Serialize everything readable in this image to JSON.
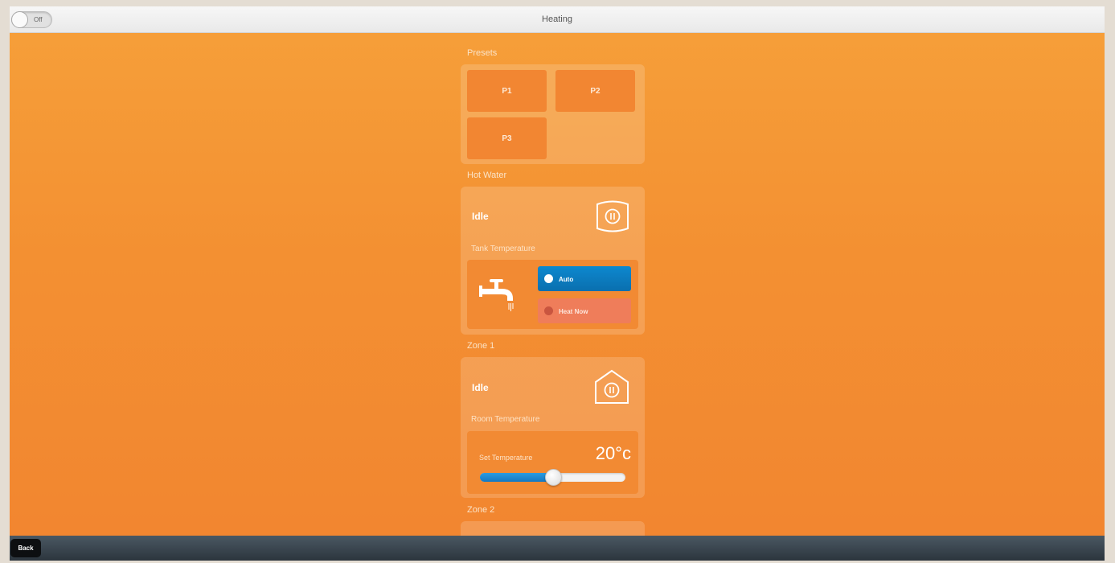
{
  "header": {
    "title": "Heating",
    "power_toggle_label": "Off"
  },
  "presets": {
    "label": "Presets",
    "buttons": [
      {
        "label": "P1"
      },
      {
        "label": "P2"
      },
      {
        "label": "P3"
      }
    ]
  },
  "hot_water": {
    "label": "Hot Water",
    "status": "Idle",
    "temperature_label": "Tank Temperature",
    "auto_label": "Auto",
    "heat_now_label": "Heat Now",
    "icon": "tank-pause-icon",
    "tap_icon": "tap-icon"
  },
  "zone1": {
    "label": "Zone 1",
    "status": "Idle",
    "temperature_label": "Room Temperature",
    "set_temperature_label": "Set Temperature",
    "set_temperature_value": "20°c",
    "slider_level": 0.5,
    "icon": "house-pause-icon"
  },
  "zone2": {
    "label": "Zone 2"
  },
  "footer": {
    "back_label": "Back"
  },
  "colors": {
    "background": "#f39032",
    "tile": "#f28632",
    "accent_blue": "#0a7bc1",
    "heat_now": "#ef7d5a",
    "footer": "#2c353d"
  }
}
